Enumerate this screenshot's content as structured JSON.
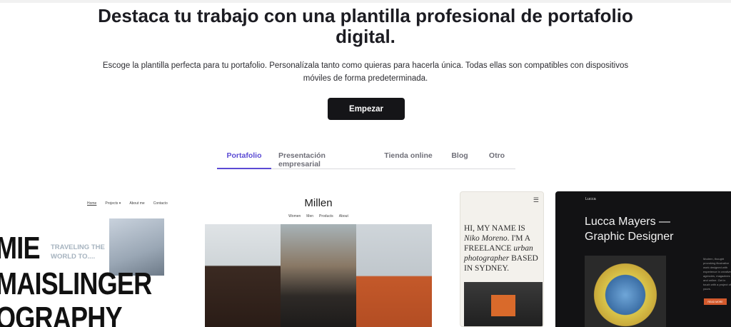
{
  "hero": {
    "title": "Destaca tu trabajo con una plantilla profesional de portafolio digital.",
    "subtitle": "Escoge la plantilla perfecta para tu portafolio. Personalízala tanto como quieras para hacerla única. Todas ellas son compatibles con dispositivos móviles de forma predeterminada.",
    "cta_label": "Empezar"
  },
  "tabs": [
    {
      "label": "Portafolio",
      "active": true
    },
    {
      "label": "Presentación empresarial",
      "active": false
    },
    {
      "label": "Tienda online",
      "active": false
    },
    {
      "label": "Blog",
      "active": false
    },
    {
      "label": "Otro",
      "active": false
    }
  ],
  "colors": {
    "accent": "#5b4bd4",
    "cta_bg": "#151518"
  },
  "previews": {
    "photography": {
      "nav": [
        "Home",
        "Projects ▾",
        "About me",
        "Contacto"
      ],
      "tagline_1": "TRAVELING THE",
      "tagline_2": "WORLD TO....",
      "big_1": "MIE",
      "big_2": "MAISLINGER",
      "big_3": "OGRAPHY"
    },
    "millen": {
      "title": "Millen",
      "nav": [
        "Women",
        "Men",
        "Products",
        "About"
      ]
    },
    "niko": {
      "menu_icon": "hamburger-icon",
      "line_1": "HI, MY NAME IS",
      "name": "Niko Moreno",
      "line_2": ". I'M A FREELANCE",
      "style": "urban photographer",
      "line_3": "BASED IN SYDNEY."
    },
    "lucca": {
      "brand": "Lucca",
      "headline_1": "Lucca Mayers —",
      "headline_2": "Graphic Designer",
      "copy": "Modern, thought provoking illustrative work designed with experience in creative agencies, magazines and online. Get in touch with a project of yours.",
      "button": "READ MORE"
    }
  }
}
